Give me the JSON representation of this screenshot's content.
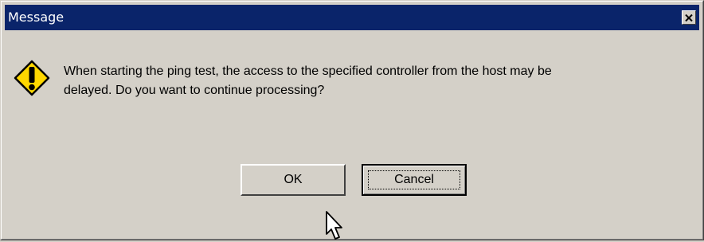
{
  "window": {
    "title": "Message"
  },
  "icons": {
    "close": "close-icon",
    "warning": "warning-icon",
    "cursor": "mouse-pointer-icon"
  },
  "message": {
    "line1": "When starting the ping test, the access to the specified controller from the host may be",
    "line2": "delayed. Do you want to continue processing?"
  },
  "buttons": {
    "ok_label": "OK",
    "cancel_label": "Cancel"
  },
  "colors": {
    "titlebar": "#0a246a",
    "dialog_face": "#d4d0c8",
    "warning_fill": "#ffd700"
  }
}
